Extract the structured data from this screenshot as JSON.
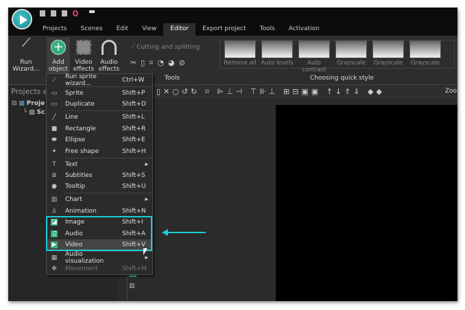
{
  "tabs": [
    "Projects",
    "Scenes",
    "Edit",
    "View",
    "Editor",
    "Export project",
    "Tools",
    "Activation"
  ],
  "active_tab": "Editor",
  "ribbon": {
    "run_wizard": [
      "Run",
      "Wizard..."
    ],
    "add_object": [
      "Add",
      "object"
    ],
    "video_effects": [
      "Video",
      "effects"
    ],
    "audio_effects": [
      "Audio",
      "effects"
    ],
    "cutting": "Cutting and splitting",
    "tools_label": "Tools",
    "quick_style_label": "Choosing quick style",
    "quick_styles": [
      "Remove all",
      "Auto levels",
      "Auto contrast",
      "Grayscale",
      "Grayscale",
      "Grayscale"
    ]
  },
  "zoom_label": "Zoo",
  "left_panel": {
    "title": "Projects ex",
    "tree": [
      "Proje",
      "Sc"
    ]
  },
  "menu": [
    {
      "label": "Run sprite wizard...",
      "shortcut": "Ctrl+W",
      "icon": "wand-icon"
    },
    {
      "label": "Sprite",
      "shortcut": "Shift+P",
      "icon": "sprite-icon"
    },
    {
      "label": "Duplicate",
      "shortcut": "Shift+D",
      "icon": "duplicate-icon"
    },
    {
      "label": "Line",
      "shortcut": "Shift+L",
      "icon": "line-icon"
    },
    {
      "label": "Rectangle",
      "shortcut": "Shift+R",
      "icon": "rectangle-icon"
    },
    {
      "label": "Ellipse",
      "shortcut": "Shift+E",
      "icon": "ellipse-icon"
    },
    {
      "label": "Free shape",
      "shortcut": "Shift+H",
      "icon": "free-shape-icon"
    },
    {
      "label": "Text",
      "shortcut": "",
      "icon": "text-icon",
      "submenu": true
    },
    {
      "label": "Subtitles",
      "shortcut": "Shift+S",
      "icon": "subtitles-icon"
    },
    {
      "label": "Tooltip",
      "shortcut": "Shift+U",
      "icon": "tooltip-icon"
    },
    {
      "label": "Chart",
      "shortcut": "",
      "icon": "chart-icon",
      "submenu": true
    },
    {
      "label": "Animation",
      "shortcut": "Shift+N",
      "icon": "animation-icon"
    },
    {
      "label": "Image",
      "shortcut": "Shift+I",
      "icon": "image-icon"
    },
    {
      "label": "Audio",
      "shortcut": "Shift+A",
      "icon": "audio-icon"
    },
    {
      "label": "Video",
      "shortcut": "Shift+V",
      "icon": "video-icon"
    },
    {
      "label": "Audio visualization",
      "shortcut": "",
      "icon": "audio-visualization-icon",
      "submenu": true
    },
    {
      "label": "Movement",
      "shortcut": "Shift+M",
      "icon": "movement-icon",
      "disabled": true
    }
  ],
  "colors": {
    "highlight": "#1ecbd8",
    "accent_green": "#33b07a"
  }
}
